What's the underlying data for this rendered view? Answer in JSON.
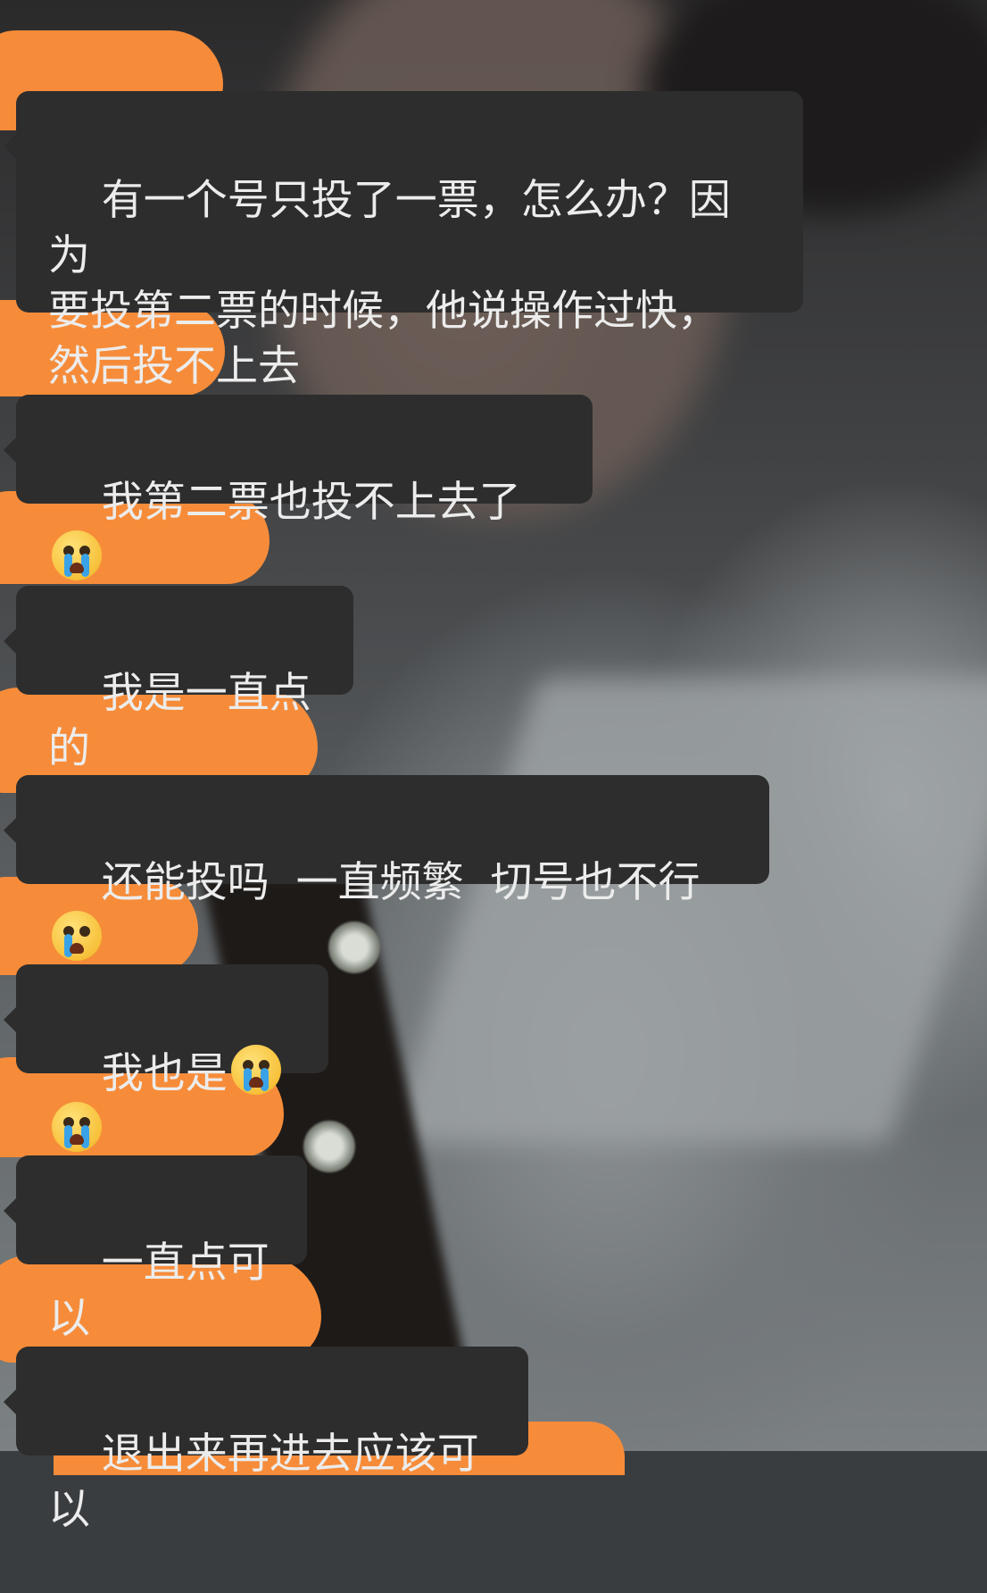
{
  "colors": {
    "bubble_background": "#2d2d2d",
    "bubble_text": "#ececec",
    "redaction_orange": "#f68c3a"
  },
  "messages": [
    {
      "text": "有一个号只投了一票，怎么办？因为\n要投第二票的时候，他说操作过快，\n然后投不上去",
      "emoji": []
    },
    {
      "text": "我第二票也投不上去了",
      "emoji": [
        "loudly-crying-face-icon"
      ]
    },
    {
      "text": "我是一直点的",
      "emoji": []
    },
    {
      "text": "还能投吗  一直频繁  切号也不行",
      "emoji": [
        "crying-face-icon"
      ]
    },
    {
      "text": "我也是",
      "emoji": [
        "loudly-crying-face-icon",
        "loudly-crying-face-icon"
      ]
    },
    {
      "text": "一直点可以",
      "emoji": []
    },
    {
      "text": "退出来再进去应该可以",
      "emoji": []
    }
  ]
}
